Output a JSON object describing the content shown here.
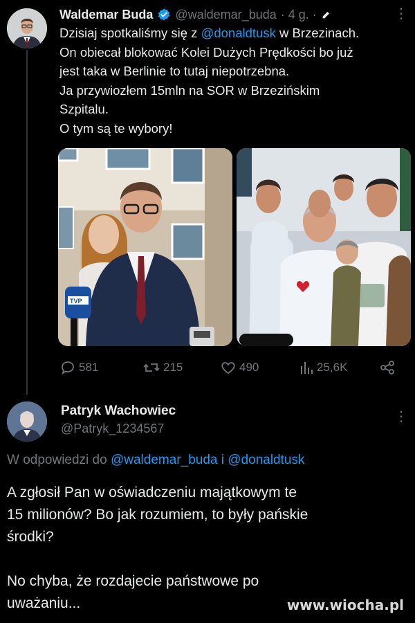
{
  "tweet": {
    "author_name": "Waldemar Buda",
    "handle": "@waldemar_buda",
    "time": "· 4 g. ·",
    "lines": [
      {
        "pre": "Dzisiaj spotkaliśmy się z ",
        "mention": "@donaldtusk",
        "post": " w Brzezinach."
      },
      {
        "text": "On obiecał blokować Kolei Dużych Prędkości bo już"
      },
      {
        "text": "jest taka w Berlinie to tutaj niepotrzebna."
      },
      {
        "text": "Ja przywiozłem 15mln na SOR w Brzezińskim"
      },
      {
        "text": "Szpitalu."
      },
      {
        "text": "O tym są te wybory!"
      }
    ],
    "photo1_sign": "TVP",
    "stats": {
      "replies": "581",
      "retweets": "215",
      "likes": "490",
      "views": "25,6K"
    }
  },
  "reply": {
    "author_name": "Patryk Wachowiec",
    "handle": "@Patryk_1234567",
    "in_reply_prefix": "W odpowiedzi do",
    "in_reply_mention1": "@waldemar_buda",
    "in_reply_conj": "i",
    "in_reply_mention2": "@donaldtusk",
    "lines": [
      "A zgłosił Pan w oświadczeniu majątkowym te",
      "15 milionów? Bo jak rozumiem, to były pańskie",
      "środki?",
      "",
      "No chyba, że rozdajecie państwowe po",
      "uważaniu..."
    ]
  },
  "watermark": "www.wiocha.pl",
  "colors": {
    "background": "#000000",
    "text": "#e7e9ea",
    "muted": "#71767b",
    "link": "#1d9bf0",
    "verified": "#1d9bf0"
  }
}
